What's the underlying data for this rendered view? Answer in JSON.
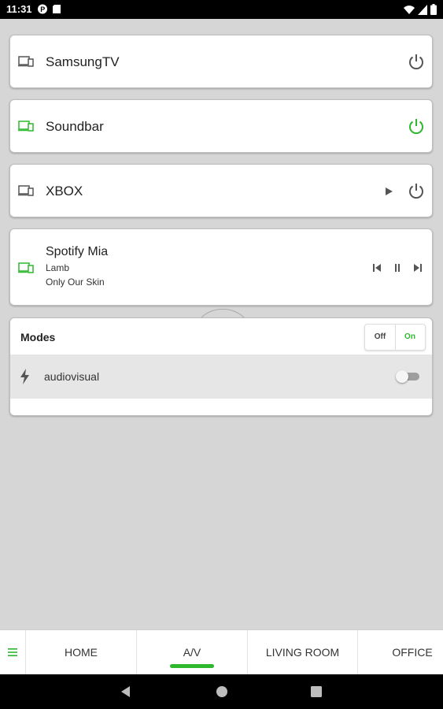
{
  "status_bar": {
    "time": "11:31",
    "left_icons": [
      "notification-p-icon",
      "sd-card-icon"
    ],
    "right_icons": [
      "wifi-icon",
      "signal-icon",
      "battery-icon"
    ]
  },
  "devices": [
    {
      "name": "SamsungTV",
      "active": false,
      "icon": "tv-device-icon",
      "power_icon": "power-icon"
    },
    {
      "name": "Soundbar",
      "active": true,
      "icon": "tv-device-icon",
      "power_icon": "power-icon"
    },
    {
      "name": "XBOX",
      "active": false,
      "icon": "tv-device-icon",
      "power_icon": "power-icon",
      "play_icon": "play-icon"
    }
  ],
  "player": {
    "name": "Spotify Mia",
    "line1": "Lamb",
    "line2": "Only Our Skin",
    "active": true,
    "controls": [
      "previous-icon",
      "pause-icon",
      "next-icon"
    ]
  },
  "modes": {
    "title": "Modes",
    "off_label": "Off",
    "on_label": "On",
    "items": [
      {
        "label": "audiovisual",
        "icon": "bolt-icon",
        "enabled": false
      }
    ]
  },
  "tabs": [
    {
      "label": "HOME",
      "active": false
    },
    {
      "label": "A/V",
      "active": true
    },
    {
      "label": "LIVING ROOM",
      "active": false
    },
    {
      "label": "OFFICE",
      "active": false
    }
  ],
  "colors": {
    "accent": "#2eb82e",
    "background": "#d6d6d6",
    "inactive_icon": "#555555"
  }
}
